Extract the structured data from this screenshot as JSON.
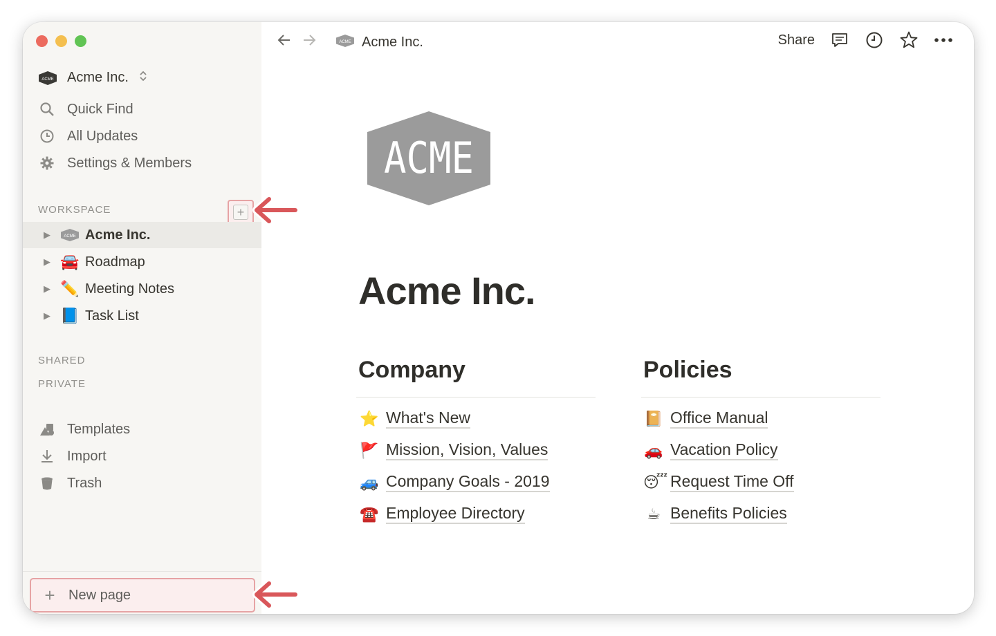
{
  "window": {
    "traffic_lights": [
      "#ec6b5f",
      "#f4bf4f",
      "#61c454"
    ]
  },
  "sidebar": {
    "workspace_name": "Acme Inc.",
    "workspace_switch_icon": "chevron-up-down-icon",
    "nav": [
      {
        "label": "Quick Find",
        "icon": "search-icon"
      },
      {
        "label": "All Updates",
        "icon": "clock-icon"
      },
      {
        "label": "Settings & Members",
        "icon": "gear-icon"
      }
    ],
    "sections": {
      "workspace": "WORKSPACE",
      "shared": "SHARED",
      "private": "PRIVATE"
    },
    "tree": [
      {
        "label": "Acme Inc.",
        "emoji": "acme-logo",
        "active": true
      },
      {
        "label": "Roadmap",
        "emoji": "🚘"
      },
      {
        "label": "Meeting Notes",
        "emoji": "✏️"
      },
      {
        "label": "Task List",
        "emoji": "📘"
      }
    ],
    "utilities": [
      {
        "label": "Templates",
        "icon": "templates-icon"
      },
      {
        "label": "Import",
        "icon": "import-icon"
      },
      {
        "label": "Trash",
        "icon": "trash-icon"
      }
    ],
    "new_page": "New page"
  },
  "topbar": {
    "breadcrumb": "Acme Inc.",
    "share": "Share",
    "icons": [
      "comment-icon",
      "history-clock-icon",
      "star-icon",
      "more-icon"
    ]
  },
  "page": {
    "logo_text": "ACME",
    "title": "Acme Inc.",
    "columns": [
      {
        "heading": "Company",
        "links": [
          {
            "emoji": "⭐",
            "label": "What's New"
          },
          {
            "emoji": "🚩",
            "label": "Mission, Vision, Values"
          },
          {
            "emoji": "🚙",
            "label": "Company Goals - 2019"
          },
          {
            "emoji": "☎️",
            "label": "Employee Directory"
          }
        ]
      },
      {
        "heading": "Policies",
        "links": [
          {
            "emoji": "📔",
            "label": "Office Manual"
          },
          {
            "emoji": "🚗",
            "label": "Vacation Policy"
          },
          {
            "emoji": "😴",
            "label": "Request Time Off"
          },
          {
            "emoji": "☕",
            "label": "Benefits Policies"
          }
        ]
      }
    ]
  },
  "colors": {
    "sidebar_bg": "#f7f6f3",
    "active_row": "#ebeae6",
    "callout_red": "#d9575a",
    "logo_gray": "#9b9b9b"
  }
}
